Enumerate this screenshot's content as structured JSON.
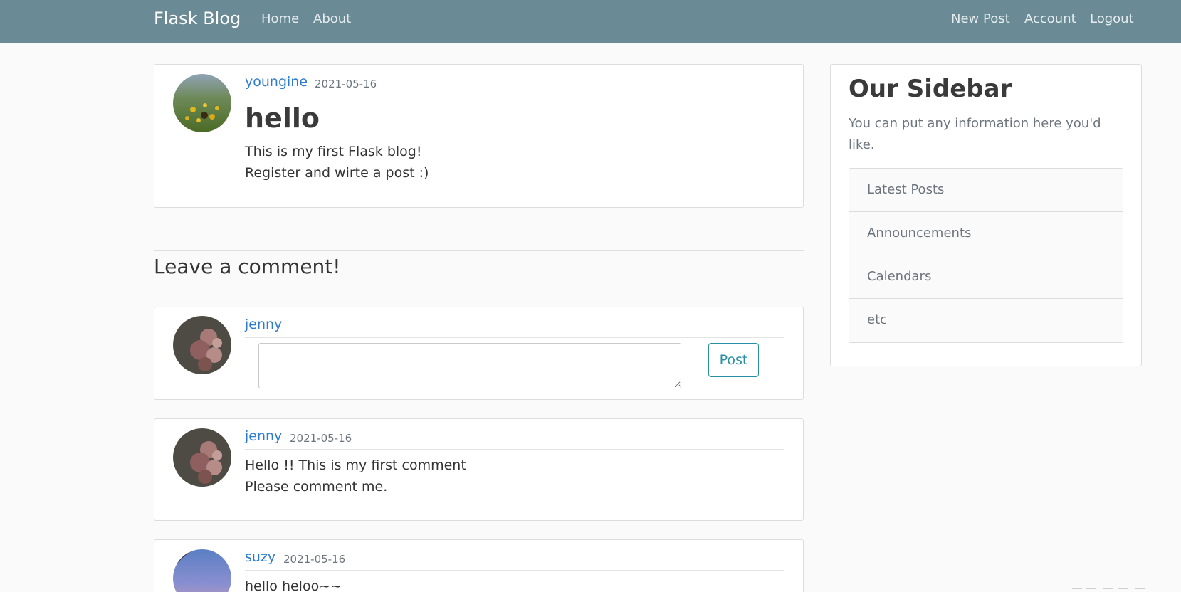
{
  "navbar": {
    "brand": "Flask Blog",
    "left_links": [
      "Home",
      "About"
    ],
    "right_links": [
      "New Post",
      "Account",
      "Logout"
    ],
    "background_color": "#6a8b95"
  },
  "post": {
    "author": "youngine",
    "date": "2021-05-16",
    "title": "hello",
    "lines": [
      "This is my first Flask blog!",
      "Register and wirte a post :)"
    ]
  },
  "comment_section": {
    "heading": "Leave a comment!",
    "form": {
      "author": "jenny",
      "textarea_value": "",
      "post_button": "Post"
    },
    "comments": [
      {
        "author": "jenny",
        "date": "2021-05-16",
        "lines": [
          "Hello !! This is my first comment",
          "Please comment me."
        ]
      },
      {
        "author": "suzy",
        "date": "2021-05-16",
        "lines": [
          "hello heloo~~"
        ]
      }
    ]
  },
  "sidebar": {
    "title": "Our Sidebar",
    "description": "You can put any information here you'd like.",
    "items": [
      "Latest Posts",
      "Announcements",
      "Calendars",
      "etc"
    ]
  },
  "colors": {
    "link": "#2d7bcf",
    "muted": "#6c757d",
    "button_outline": "#2b8fa3"
  }
}
